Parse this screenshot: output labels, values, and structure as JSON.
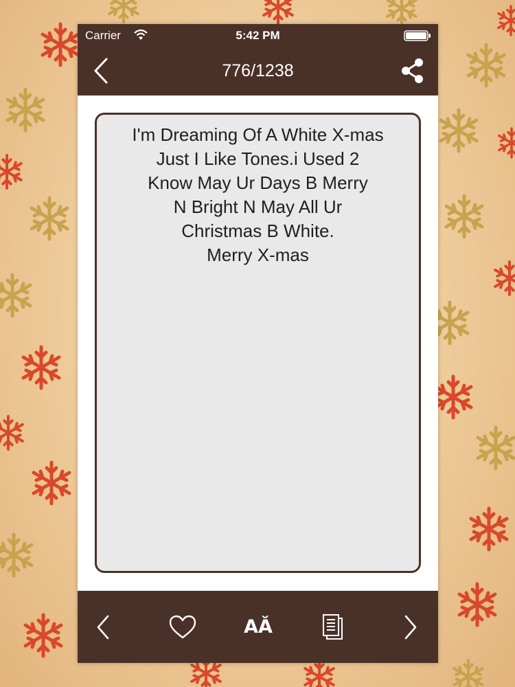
{
  "status_bar": {
    "carrier": "Carrier",
    "time": "5:42 PM"
  },
  "nav": {
    "title": "776/1238",
    "back_icon": "chevron-left-icon",
    "share_icon": "share-icon"
  },
  "message": {
    "text": "I'm Dreaming Of A White X-mas\nJust I Like Tones.i Used 2\nKnow May Ur Days B Merry\nN Bright N May All Ur\nChristmas B White.\nMerry X-mas"
  },
  "toolbar": {
    "font_label": "AǍ",
    "icons": [
      "chevron-left-icon",
      "heart-icon",
      "font-size-icon",
      "copy-icon",
      "chevron-right-icon"
    ]
  },
  "colors": {
    "bar": "#4a3128",
    "card": "#e9e9e9",
    "snowflake_red": "#d9482a",
    "snowflake_gold": "#c9a24e"
  }
}
